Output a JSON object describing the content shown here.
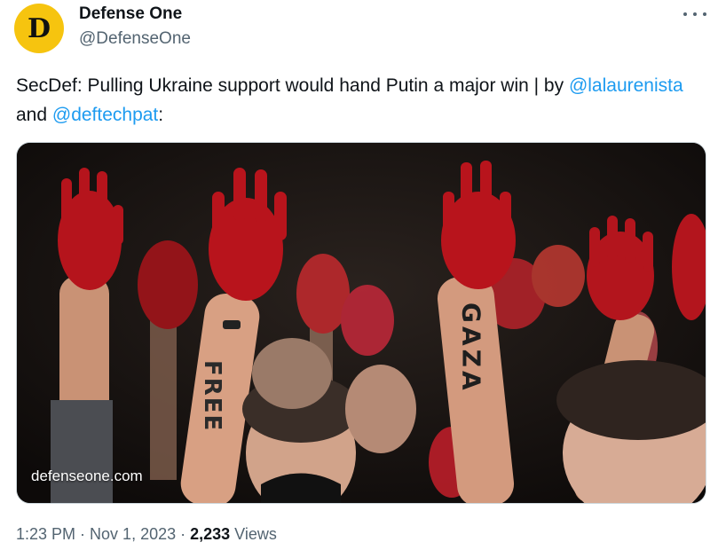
{
  "author": {
    "avatar_letter": "D",
    "avatar_color": "#f6c40f",
    "display_name": "Defense One",
    "handle": "@DefenseOne"
  },
  "tweet": {
    "text_before": "SecDef: Pulling Ukraine support would hand Putin a major win | by ",
    "mention_1": "@lalaurenista",
    "text_middle": " and ",
    "mention_2": "@deftechpat",
    "text_after": ":"
  },
  "media": {
    "watermark": "defenseone.com",
    "arm_text_1": "FREE",
    "arm_text_2": "GAZA"
  },
  "meta": {
    "time": "1:23 PM",
    "separator_1": " · ",
    "date": "Nov 1, 2023",
    "separator_2": " · ",
    "views_count": "2,233",
    "views_label": " Views"
  },
  "colors": {
    "link": "#1d9bf0",
    "secondary_text": "#536471",
    "paint_red": "#b8141c"
  }
}
